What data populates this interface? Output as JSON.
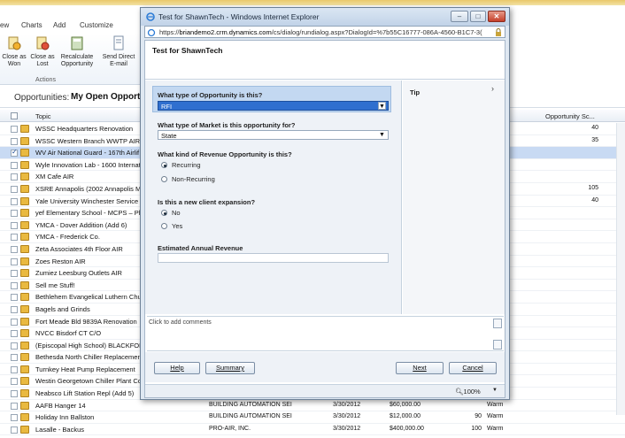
{
  "ribbon": {
    "tabs": [
      "ew",
      "Charts",
      "Add",
      "Customize"
    ],
    "buttons": [
      {
        "line1": "Close as",
        "line2": "Won"
      },
      {
        "line1": "Close as",
        "line2": "Lost"
      },
      {
        "line1": "Recalculate",
        "line2": "Opportunity"
      },
      {
        "line1": "Send Direct",
        "line2": "E-mail"
      }
    ],
    "group_label": "Actions"
  },
  "view": {
    "label": "Opportunities:",
    "name": "My Open Opportu"
  },
  "grid": {
    "col_topic": "Topic",
    "col_score": "Opportunity Sc...",
    "rows": [
      {
        "topic": "WSSC Headquarters Renovation",
        "score": "40"
      },
      {
        "topic": "WSSC Western Branch WWTP AIR",
        "score": "35"
      },
      {
        "topic": "WV Air National Guard - 167th Airlif",
        "selected": true
      },
      {
        "topic": "Wyle Innovation Lab - 1600 Internat"
      },
      {
        "topic": "XM Cafe AIR"
      },
      {
        "topic": "XSRE Annapolis (2002 Annapolis Ma",
        "score": "105"
      },
      {
        "topic": "Yale University Winchester Service B",
        "score": "40"
      },
      {
        "topic": "yef Elementary School - MCPS – Pha"
      },
      {
        "topic": "YMCA - Dover Addition (Add 6)"
      },
      {
        "topic": "YMCA - Frederick Co."
      },
      {
        "topic": "Zeta Associates 4th Floor AIR"
      },
      {
        "topic": "Zoes Reston AIR"
      },
      {
        "topic": "Zumiez Leesburg Outlets AIR"
      },
      {
        "topic": "Sell me Stuff!"
      },
      {
        "topic": "Bethlehem Evangelical Luthern Chu"
      },
      {
        "topic": "Bagels and Grinds"
      },
      {
        "topic": "Fort Meade Bld 9839A Renovation"
      },
      {
        "topic": "NVCC Bisdorf CT C/O"
      },
      {
        "topic": "(Episcopal High School) BLACKFORD"
      },
      {
        "topic": "Bethesda North Chiller Replacemen"
      },
      {
        "topic": "Turnkey Heat Pump Replacement"
      },
      {
        "topic": "Westin Georgetown Chiller Plant Co"
      },
      {
        "topic": "Neabsco Lift Station Repl (Add 5)"
      },
      {
        "topic": "AAFB Hanger 14",
        "account": "BUILDING AUTOMATION SEI",
        "date": "3/30/2012",
        "revenue": "$60,000.00",
        "prob": "",
        "rating": "Warm"
      },
      {
        "topic": "Holiday Inn Ballston",
        "account": "BUILDING AUTOMATION SEI",
        "date": "3/30/2012",
        "revenue": "$12,000.00",
        "prob": "90",
        "rating": "Warm"
      },
      {
        "topic": "Lasalle - Backus",
        "account": "PRO-AIR, INC.",
        "date": "3/30/2012",
        "revenue": "$400,000.00",
        "prob": "100",
        "rating": "Warm"
      }
    ]
  },
  "window": {
    "title": "Test for ShawnTech - Windows Internet Explorer",
    "url_prefix": "https://",
    "url_host": "briandemo2.crm.dynamics.com",
    "url_path": "/cs/dialog/rundialog.aspx?DialogId=%7b55C16777-086A-4560-B1C7-3(",
    "minimize": "–",
    "maximize": "□",
    "close": "✕"
  },
  "dialog": {
    "heading": "Test for ShawnTech",
    "tip_label": "Tip",
    "tip_toggle": "›",
    "q1": {
      "label": "What type of Opportunity is this?",
      "value": "RFI"
    },
    "q2": {
      "label": "What type of Market is this opportunity for?",
      "value": "State"
    },
    "q3": {
      "label": "What kind of Revenue Opportunity is this?",
      "options": [
        "Recurring",
        "Non-Recurring"
      ],
      "selected": 0
    },
    "q4": {
      "label": "Is this a new client expansion?",
      "options": [
        "No",
        "Yes"
      ],
      "selected": 0
    },
    "q5": {
      "label": "Estimated Annual Revenue",
      "value": ""
    },
    "comments_placeholder": "Click to add comments",
    "buttons": {
      "help": "Help",
      "summary": "Summary",
      "next": "Next",
      "cancel": "Cancel"
    },
    "zoom": "100%"
  },
  "colors": {
    "selected_field": "#2f6fcf",
    "question_highlight": "#c3d8f1",
    "selected_row": "#c8daf3"
  }
}
